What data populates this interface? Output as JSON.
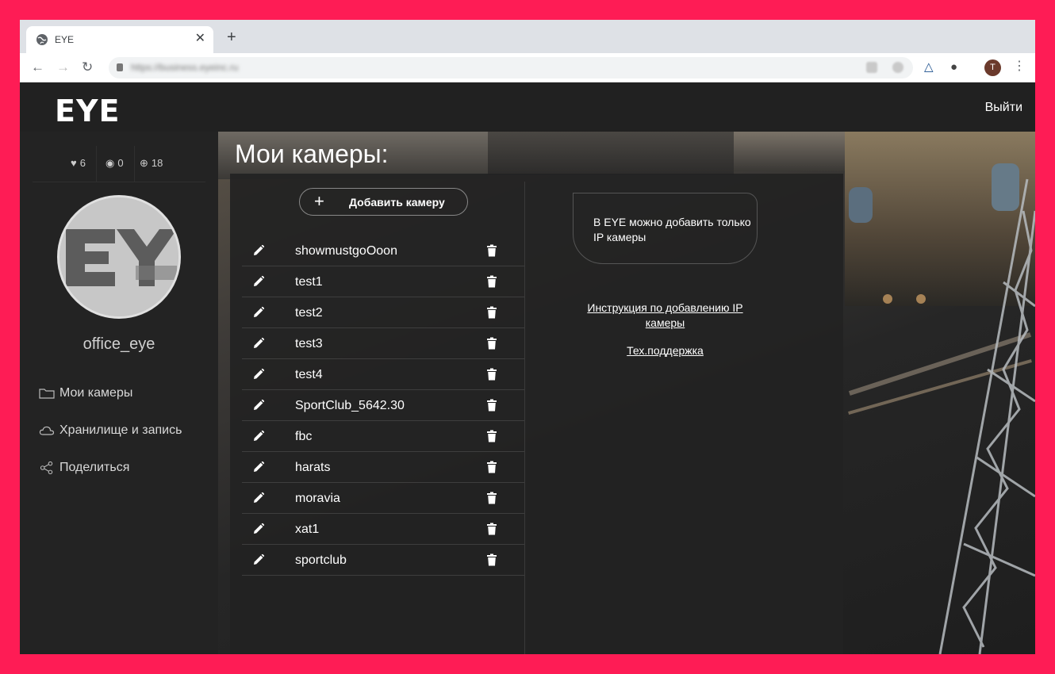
{
  "browser": {
    "tab_title": "EYE",
    "url": "https://business.eyeinc.ru",
    "profile_initial": "T"
  },
  "header": {
    "logo": "EYE",
    "logout": "Выйти"
  },
  "sidebar": {
    "stats": [
      {
        "icon": "heart-icon",
        "value": "6"
      },
      {
        "icon": "eye-icon",
        "value": "0"
      },
      {
        "icon": "plus-circle-icon",
        "value": "18"
      }
    ],
    "username": "office_eye",
    "nav": [
      {
        "icon": "folder-icon",
        "label": "Мои камеры"
      },
      {
        "icon": "cloud-icon",
        "label": "Хранилище и запись"
      },
      {
        "icon": "share-icon",
        "label": "Поделиться"
      }
    ]
  },
  "main": {
    "title": "Мои камеры:",
    "add_button": "Добавить камеру",
    "cameras": [
      "showmustgoOoon",
      "test1",
      "test2",
      "test3",
      "test4",
      "SportClub_5642.30",
      "fbc",
      "harats",
      "moravia",
      "xat1",
      "sportclub"
    ],
    "info": "В EYE можно добавить только IP камеры",
    "instruction_link": "Инструкция по добавлению IP камеры",
    "support_link": "Тех.поддержка"
  }
}
